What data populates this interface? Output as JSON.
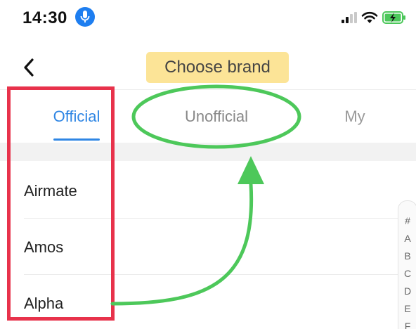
{
  "status_bar": {
    "time": "14:30",
    "icons": [
      "microphone-icon",
      "signal-icon",
      "wifi-icon",
      "battery-charging-icon"
    ]
  },
  "nav": {
    "back_icon": "chevron-left-icon",
    "title": "Choose brand"
  },
  "tabs": [
    {
      "label": "Official",
      "active": true
    },
    {
      "label": "Unofficial",
      "active": false
    },
    {
      "label": "My",
      "active": false
    }
  ],
  "brands": [
    {
      "label": "Airmate"
    },
    {
      "label": "Amos"
    },
    {
      "label": "Alpha"
    }
  ],
  "index_letters": [
    "#",
    "A",
    "B",
    "C",
    "D",
    "E",
    "F"
  ],
  "colors": {
    "accent": "#2f86e4",
    "title_highlight": "#fce497",
    "annotation_red": "#e8324b",
    "annotation_green": "#4dc85a"
  }
}
